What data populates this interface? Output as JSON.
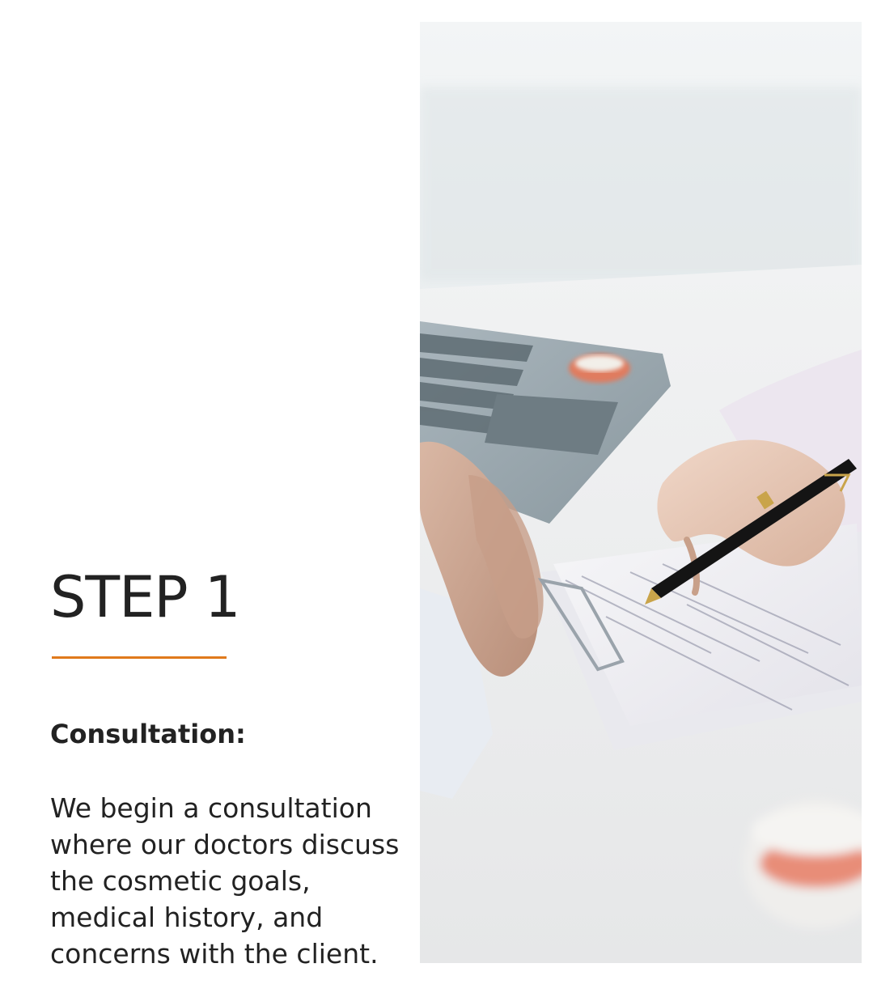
{
  "step": {
    "title": "STEP 1",
    "accent_color": "#e07a1c"
  },
  "content": {
    "heading": "Consultation:",
    "body": "We begin a consultation where our doctors discuss the cosmetic goals, medical history, and concerns with the client."
  },
  "photo": {
    "subject": "doctor-consultation-photo"
  }
}
